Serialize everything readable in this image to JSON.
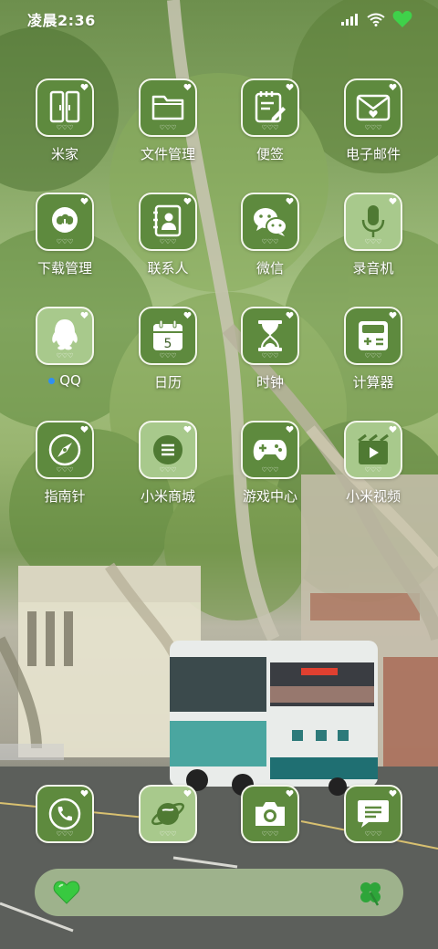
{
  "status_bar": {
    "time": "凌晨2:36",
    "icons": [
      "signal-icon",
      "wifi-icon",
      "battery-heart-icon"
    ]
  },
  "apps": [
    {
      "label": "米家",
      "icon": "mijia-doors-icon",
      "tile": "dark"
    },
    {
      "label": "文件管理",
      "icon": "folder-icon",
      "tile": "dark"
    },
    {
      "label": "便签",
      "icon": "notepad-pen-icon",
      "tile": "dark"
    },
    {
      "label": "电子邮件",
      "icon": "envelope-heart-icon",
      "tile": "dark"
    },
    {
      "label": "下载管理",
      "icon": "cloud-download-icon",
      "tile": "dark"
    },
    {
      "label": "联系人",
      "icon": "contacts-book-icon",
      "tile": "dark"
    },
    {
      "label": "微信",
      "icon": "wechat-icon",
      "tile": "dark"
    },
    {
      "label": "录音机",
      "icon": "microphone-icon",
      "tile": "light"
    },
    {
      "label": "QQ",
      "icon": "qq-penguin-icon",
      "tile": "light",
      "badge": "dot"
    },
    {
      "label": "日历",
      "icon": "calendar-icon",
      "tile": "dark",
      "day": "5"
    },
    {
      "label": "时钟",
      "icon": "hourglass-icon",
      "tile": "dark"
    },
    {
      "label": "计算器",
      "icon": "calculator-icon",
      "tile": "dark"
    },
    {
      "label": "指南针",
      "icon": "compass-icon",
      "tile": "dark"
    },
    {
      "label": "小米商城",
      "icon": "store-menu-icon",
      "tile": "light"
    },
    {
      "label": "游戏中心",
      "icon": "gamepad-icon",
      "tile": "dark"
    },
    {
      "label": "小米视频",
      "icon": "video-clapper-icon",
      "tile": "light"
    }
  ],
  "dock": [
    {
      "icon": "phone-icon",
      "tile": "dark"
    },
    {
      "icon": "browser-planet-icon",
      "tile": "light"
    },
    {
      "icon": "camera-icon",
      "tile": "dark"
    },
    {
      "icon": "message-bubble-icon",
      "tile": "dark"
    }
  ],
  "dock_bar": {
    "left_icon": "green-heart-icon",
    "right_icon": "four-leaf-clover-icon"
  },
  "colors": {
    "tile_dark": "#5e8a3e",
    "tile_light": "#a8c98c",
    "tile_border": "#f4f7ec",
    "badge_dot": "#2f8ff2",
    "battery_heart": "#3fd14a"
  },
  "tile_hearts": "♡♡♡"
}
